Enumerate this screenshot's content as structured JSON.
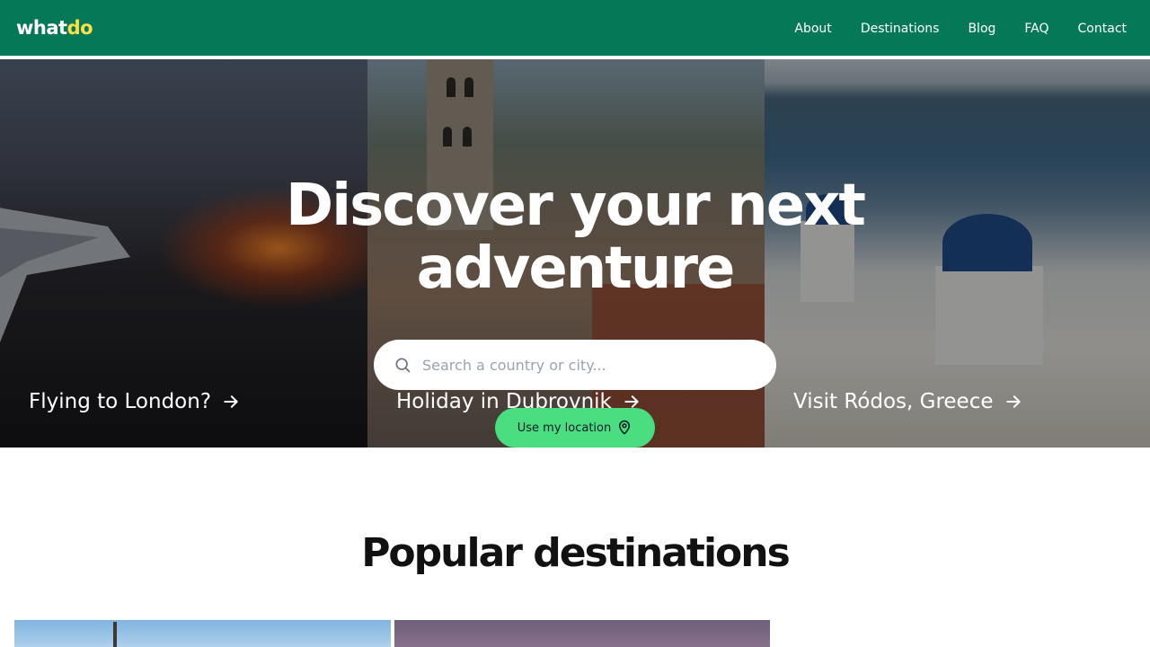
{
  "brand": {
    "logo_main": "what",
    "logo_accent": "do"
  },
  "nav": {
    "items": [
      "About",
      "Destinations",
      "Blog",
      "FAQ",
      "Contact"
    ]
  },
  "hero": {
    "title": "Discover your next adventure",
    "panels": [
      {
        "label": "Flying to London?"
      },
      {
        "label": "Holiday in Dubrovnik"
      },
      {
        "label": "Visit Ródos, Greece"
      }
    ],
    "search": {
      "placeholder": "Search a country or city..."
    },
    "location_button": "Use my location"
  },
  "popular": {
    "title": "Popular destinations"
  },
  "colors": {
    "header": "#047857",
    "logo_accent": "#fde047",
    "location_button": "#4ade80"
  },
  "icons": {
    "search": "search-icon",
    "arrow": "arrow-right-icon",
    "location": "map-pin-icon"
  }
}
